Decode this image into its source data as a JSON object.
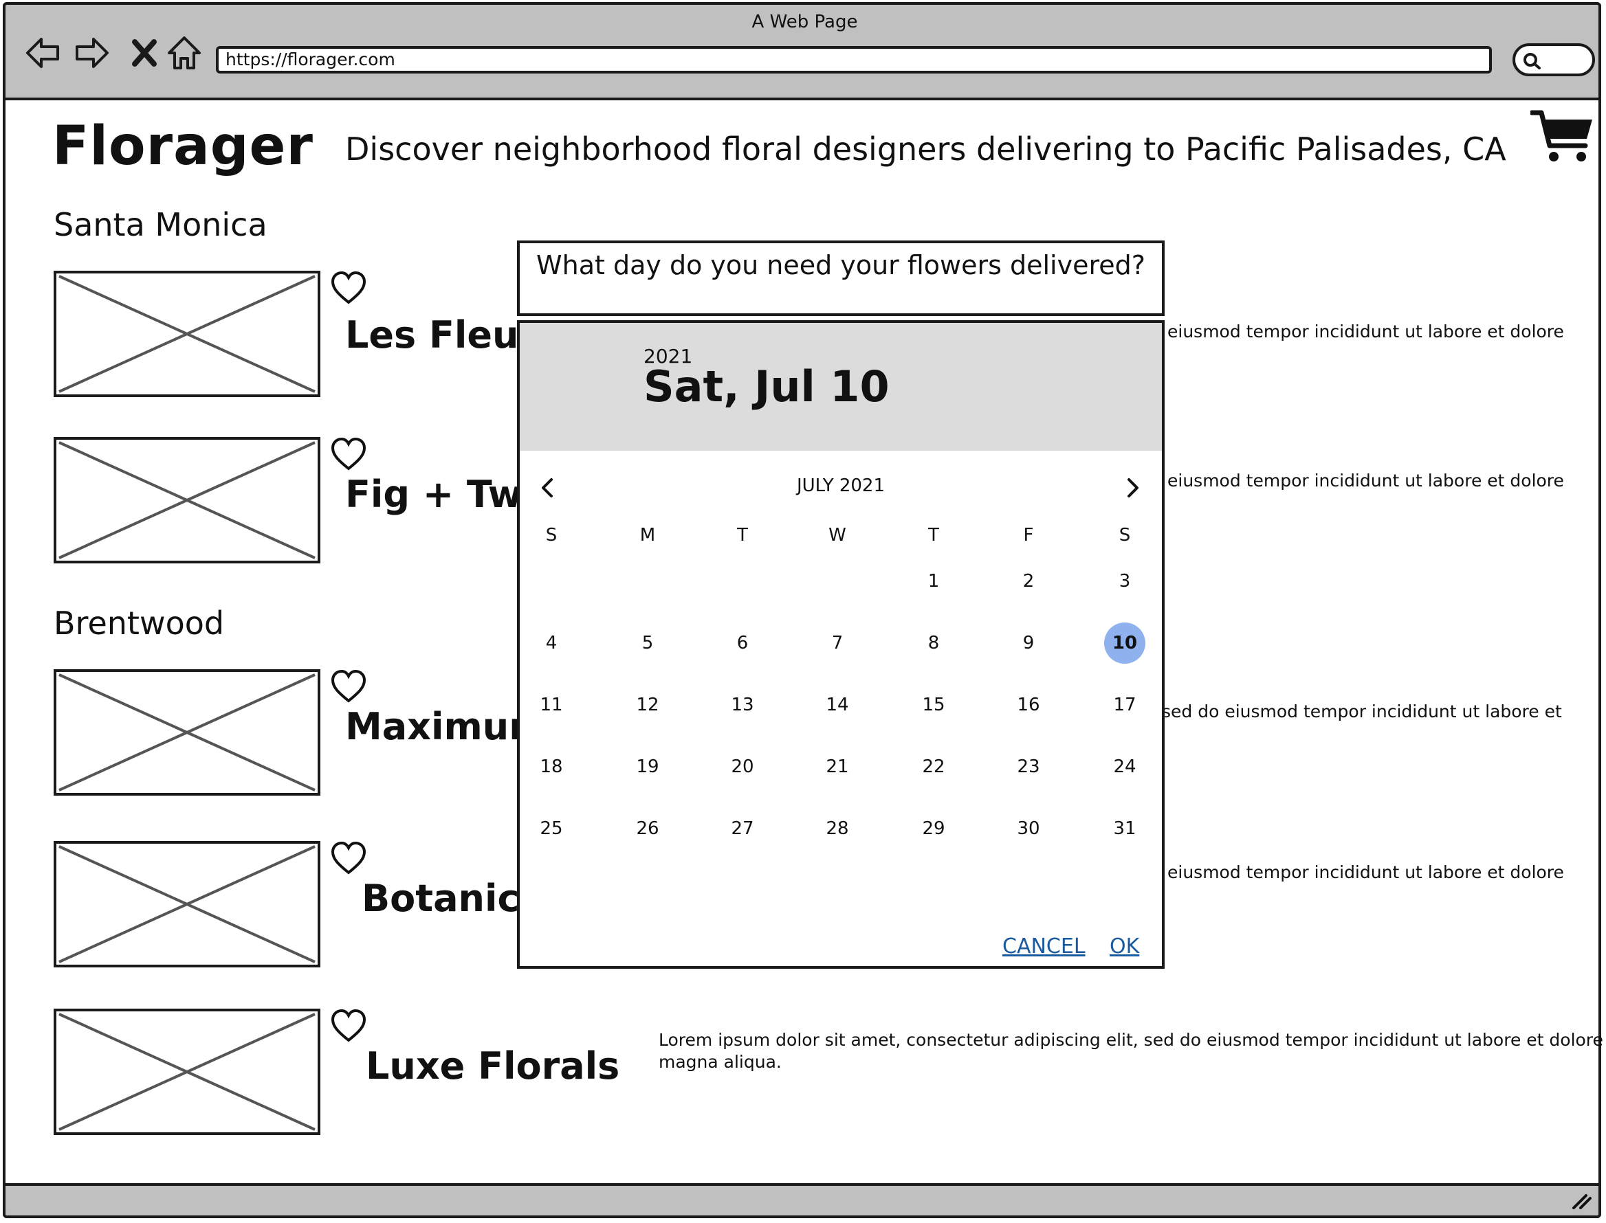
{
  "browser": {
    "window_title": "A Web Page",
    "url": "https://florager.com"
  },
  "header": {
    "logo": "Florager",
    "tagline": "Discover neighborhood floral designers delivering to Pacific Palisades, CA"
  },
  "sections": [
    {
      "title": "Santa Monica",
      "shops": [
        {
          "name": "Les Fleurs",
          "description": "eiusmod tempor incididunt ut labore et dolore"
        },
        {
          "name": "Fig + Twin",
          "description": "eiusmod tempor incididunt ut labore et dolore"
        }
      ]
    },
    {
      "title": "Brentwood",
      "shops": [
        {
          "name": "Maximum",
          "description": "sed do eiusmod tempor incididunt ut labore et"
        },
        {
          "name": "Botanica",
          "description": "eiusmod tempor incididunt ut labore et dolore"
        },
        {
          "name": "Luxe Florals",
          "description": "Lorem ipsum dolor sit amet, consectetur adipiscing elit, sed do eiusmod tempor incididunt ut labore et dolore",
          "description_line2": "magna aliqua."
        }
      ]
    }
  ],
  "modal": {
    "question": "What day do you need your flowers delivered?",
    "selected_year": "2021",
    "selected_date": "Sat, Jul 10",
    "month_label": "JULY 2021",
    "weekdays": [
      "S",
      "M",
      "T",
      "W",
      "T",
      "F",
      "S"
    ],
    "weeks": [
      [
        "",
        "",
        "",
        "",
        "1",
        "2",
        "3"
      ],
      [
        "4",
        "5",
        "6",
        "7",
        "8",
        "9",
        "10"
      ],
      [
        "11",
        "12",
        "13",
        "14",
        "15",
        "16",
        "17"
      ],
      [
        "18",
        "19",
        "20",
        "21",
        "22",
        "23",
        "24"
      ],
      [
        "25",
        "26",
        "27",
        "28",
        "29",
        "30",
        "31"
      ]
    ],
    "selected_day": "10",
    "cancel_label": "CANCEL",
    "ok_label": "OK"
  },
  "colors": {
    "chrome": "#c0c0c0",
    "selected_day": "#8fb2ee",
    "link": "#1a5a9e",
    "dialog_header": "#dcdcdc"
  }
}
